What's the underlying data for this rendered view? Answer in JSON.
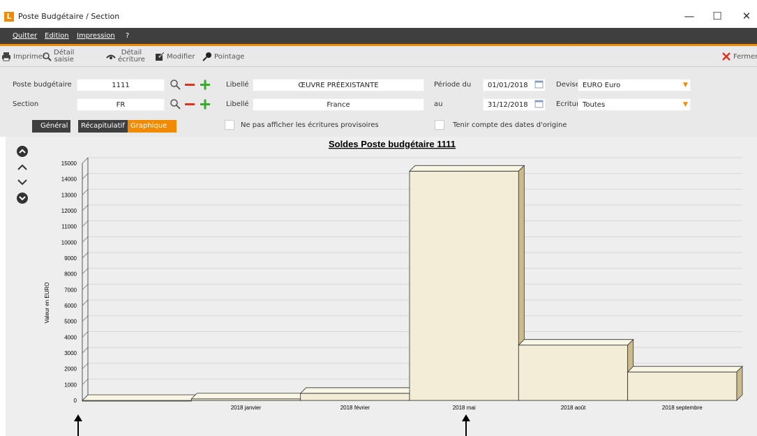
{
  "window": {
    "title": "Poste Budgétaire / Section",
    "logo_letter": "L",
    "minimize": "—",
    "maximize": "☐",
    "close": "✕"
  },
  "menu": {
    "items": [
      "Quitter",
      "Edition",
      "Impression",
      "?"
    ]
  },
  "toolbar": {
    "print_label": "Imprimer",
    "detail_saisie_1": "Détail",
    "detail_saisie_2": "saisie",
    "detail_ecriture_1": "Détail",
    "detail_ecriture_2": "écriture",
    "modify_label": "Modifier",
    "pointage_label": "Pointage",
    "close_label": "Fermer"
  },
  "form": {
    "poste_label": "Poste budgétaire",
    "poste_value": "1111",
    "libelle_label": "Libellé",
    "libelle_poste_value": "ŒUVRE PRÉEXISTANTE",
    "periode_label": "Période du",
    "periode_from": "01/01/2018",
    "devise_label": "Devise",
    "devise_value": "EURO Euro",
    "section_label": "Section",
    "section_value": "FR",
    "libelle2_label": "Libellé",
    "libelle_section_value": "France",
    "au_label": "au",
    "periode_to": "31/12/2018",
    "ecritures_label": "Ecritures",
    "ecritures_value": "Toutes",
    "checkbox_provisoires": "Ne pas afficher les écritures provisoires",
    "checkbox_origine": "Tenir compte des dates d'origine"
  },
  "tabs": [
    {
      "label": "Général",
      "active": false
    },
    {
      "label": "Récapitulatif",
      "active": false
    },
    {
      "label": "Graphique",
      "active": true
    }
  ],
  "colors": {
    "accent": "#f28a00",
    "menubar": "#3f3f3f",
    "bar_face": "#f3ecd6",
    "bar_side": "#c9bb8d"
  },
  "chart_data": {
    "type": "bar",
    "title": "Soldes Poste budgétaire 1111",
    "ylabel": "Valeur en EURO",
    "xlabel": "",
    "ylim": [
      0,
      15000
    ],
    "yticks": [
      0,
      1000,
      2000,
      3000,
      4000,
      5000,
      6000,
      7000,
      8000,
      9000,
      10000,
      11000,
      12000,
      13000,
      14000,
      15000
    ],
    "categories": [
      "",
      "2018 janvier",
      "2018 février",
      "2018 mai",
      "2018 août",
      "2018 septembre"
    ],
    "values": [
      0,
      100,
      450,
      14500,
      3500,
      1800
    ],
    "grid": true
  }
}
